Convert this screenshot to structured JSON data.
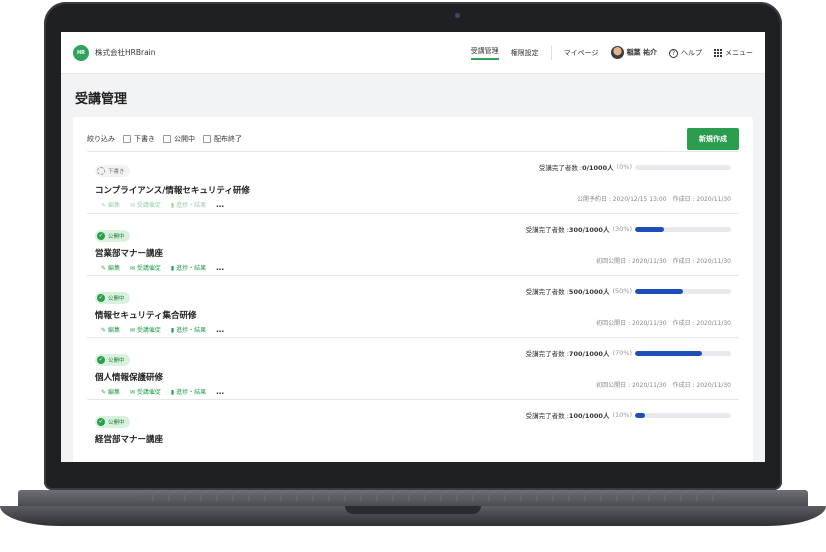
{
  "header": {
    "company": "株式会社HRBrain",
    "logo_text": "HR",
    "nav": [
      "受講管理",
      "権限設定"
    ],
    "mypage": "マイページ",
    "user": "稲葉 祐介",
    "help": "ヘルプ",
    "menu": "メニュー"
  },
  "page": {
    "title": "受講管理"
  },
  "filter": {
    "label": "絞り込み",
    "options": [
      "下書き",
      "公開中",
      "配布終了"
    ],
    "new_button": "新規作成"
  },
  "courses": [
    {
      "status": "下書き",
      "title": "コンプライアンス/情報セキュリティ研修",
      "actions": [
        "編集",
        "受講催促",
        "進捗・結果"
      ],
      "progress_label": "受講完了者数 : ",
      "progress_value": "0/1000人",
      "progress_pct": "(0%)",
      "progress": 0,
      "dates": "公開予約日 : 2020/12/15 13:00　作成日 : 2020/11/30"
    },
    {
      "status": "公開中",
      "title": "営業部マナー講座",
      "actions": [
        "編集",
        "受講催促",
        "進捗・結果"
      ],
      "progress_label": "受講完了者数 : ",
      "progress_value": "300/1000人",
      "progress_pct": "(30%)",
      "progress": 0.3,
      "dates": "初回公開日 : 2020/11/30　作成日 : 2020/11/30"
    },
    {
      "status": "公開中",
      "title": "情報セキュリティ集合研修",
      "actions": [
        "編集",
        "受講催促",
        "進捗・結果"
      ],
      "progress_label": "受講完了者数 : ",
      "progress_value": "500/1000人",
      "progress_pct": "(50%)",
      "progress": 0.5,
      "dates": "初回公開日 : 2020/11/30　作成日 : 2020/11/30"
    },
    {
      "status": "公開中",
      "title": "個人情報保護研修",
      "actions": [
        "編集",
        "受講催促",
        "進捗・結果"
      ],
      "progress_label": "受講完了者数 : ",
      "progress_value": "700/1000人",
      "progress_pct": "(70%)",
      "progress": 0.7,
      "dates": "初回公開日 : 2020/11/30　作成日 : 2020/11/30"
    },
    {
      "status": "公開中",
      "title": "経営部マナー講座",
      "progress_label": "受講完了者数 : ",
      "progress_value": "100/1000人",
      "progress_pct": "(10%)",
      "progress": 0.1
    }
  ],
  "colors": {
    "accent": "#2a9d4f",
    "progress": "#1e4fb8"
  }
}
